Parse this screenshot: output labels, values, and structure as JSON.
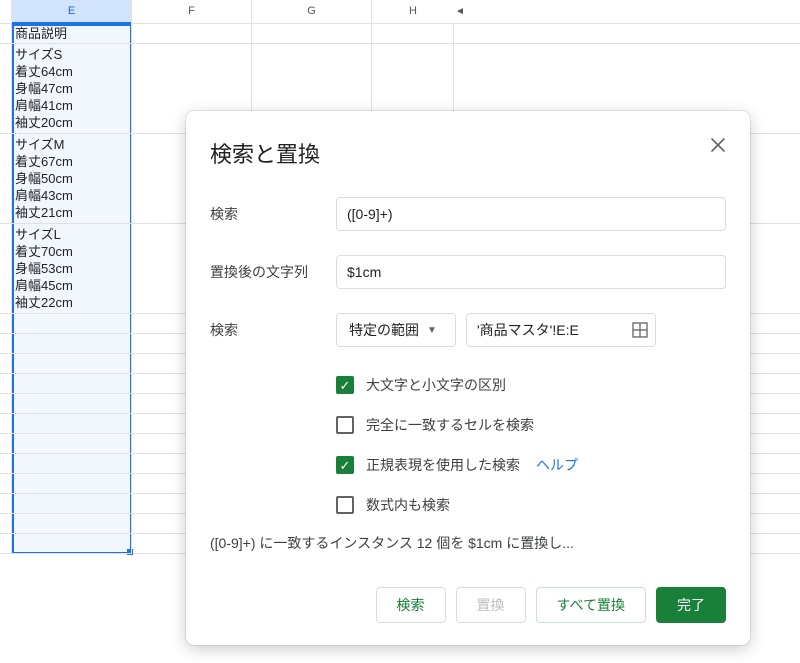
{
  "sheet": {
    "columns": [
      "E",
      "F",
      "G",
      "H"
    ],
    "selected_column": "E",
    "cells_e": [
      "商品説明",
      "サイズS\n着丈64cm\n身幅47cm\n肩幅41cm\n袖丈20cm",
      "サイズM\n着丈67cm\n身幅50cm\n肩幅43cm\n袖丈21cm",
      "サイズL\n着丈70cm\n身幅53cm\n肩幅45cm\n袖丈22cm"
    ],
    "trailing_empty_rows": 12
  },
  "dialog": {
    "title": "検索と置換",
    "labels": {
      "find": "検索",
      "replace": "置換後の文字列",
      "scope": "検索"
    },
    "find_value": "([0-9]+)",
    "replace_value": "$1cm",
    "scope_dropdown": "特定の範囲",
    "range_value": "'商品マスタ'!E:E",
    "checkboxes": {
      "match_case": {
        "checked": true,
        "label": "大文字と小文字の区別"
      },
      "match_entire": {
        "checked": false,
        "label": "完全に一致するセルを検索"
      },
      "regex": {
        "checked": true,
        "label": "正規表現を使用した検索",
        "help": "ヘルプ"
      },
      "formulas": {
        "checked": false,
        "label": "数式内も検索"
      }
    },
    "status": "([0-9]+) に一致するインスタンス 12 個を $1cm に置換し...",
    "buttons": {
      "find": "検索",
      "replace": "置換",
      "replace_all": "すべて置換",
      "done": "完了"
    }
  }
}
